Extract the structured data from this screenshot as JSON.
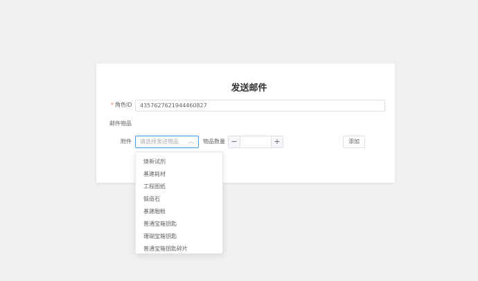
{
  "form": {
    "title": "发送邮件",
    "role_id_required_mark": "*",
    "role_id_label": "角色ID",
    "role_id_value": "4357627621944460827",
    "mail_items_label": "邮件物品",
    "attachment_label": "附件",
    "attachment_placeholder": "请选择发送物品",
    "quantity_label": "物品数量",
    "quantity_minus": "−",
    "quantity_plus": "+",
    "quantity_value": "",
    "add_button": "添加"
  },
  "dropdown": {
    "options": [
      "焕新试剂",
      "基建耗材",
      "工程图纸",
      "锻造石",
      "基建融粉",
      "普通宝箱钥匙",
      "珊瑚宝箱钥匙",
      "普通宝箱钥匙碎片"
    ]
  },
  "colors": {
    "accent": "#409eff",
    "required": "#f56c6c",
    "background": "#f0f0f0"
  }
}
